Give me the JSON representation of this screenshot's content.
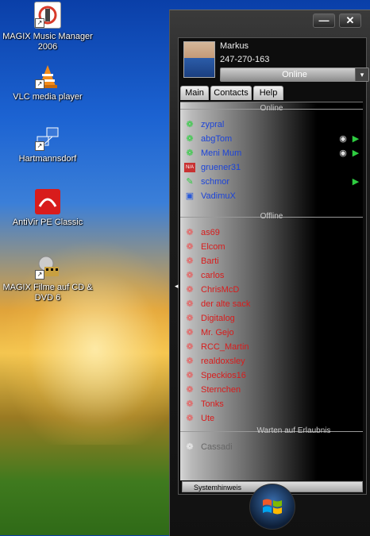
{
  "desktop": {
    "icons": [
      {
        "label": "MAGIX Music Manager 2006",
        "icon": "magix-music-icon",
        "color": "#d83a2a"
      },
      {
        "label": "VLC media player",
        "icon": "vlc-cone-icon",
        "color": "#f28c1c"
      },
      {
        "label": "Hartmannsdorf",
        "icon": "network-computers-icon",
        "color": "#3a78d8"
      },
      {
        "label": "AntiVir PE Classic",
        "icon": "antivir-umbrella-icon",
        "color": "#d81c1c"
      },
      {
        "label": "MAGIX Filme auf CD & DVD 6",
        "icon": "magix-film-icon",
        "color": "#c8a040"
      }
    ]
  },
  "window": {
    "minimize": "—",
    "close": "✕",
    "profile": {
      "name": "Markus",
      "number": "247-270-163",
      "status": "Online",
      "status_dropdown": "▾"
    },
    "tabs": [
      "Main",
      "Contacts",
      "Help"
    ],
    "groups": {
      "online": "Online",
      "offline": "Offline",
      "pending": "Warten auf Erlaubnis"
    },
    "online_contacts": [
      {
        "name": "zypral",
        "icon": "❁",
        "tags": []
      },
      {
        "name": "abgTom",
        "icon": "❁",
        "tags": [
          "webcam-icon",
          "voice-icon"
        ]
      },
      {
        "name": "Meni Mum",
        "icon": "❁",
        "tags": [
          "webcam-icon",
          "voice-icon"
        ]
      },
      {
        "name": "gruener31",
        "icon": "N/A",
        "tags": []
      },
      {
        "name": "schmor",
        "icon": "✎",
        "tags": [
          "voice-icon"
        ]
      },
      {
        "name": "VadimuX",
        "icon": "▣",
        "tags": []
      }
    ],
    "offline_contacts": [
      "as69",
      "Elcom",
      "Barti",
      "carlos",
      "ChrisMcD",
      "der alte sack",
      "Digitalog",
      "Mr. Gejo",
      "RCC_Martin",
      "realdoxsley",
      "Speckios16",
      "Sternchen",
      "Tonks",
      "Ute"
    ],
    "pending_contacts": [
      "Cassadi"
    ],
    "footer": "Systemhinweis",
    "collapse_arrow": "◂",
    "start_orb": "windows-start-orb-icon"
  }
}
